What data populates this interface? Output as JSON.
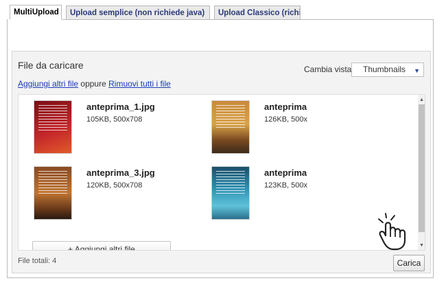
{
  "tabs": [
    {
      "label": "MultiUpload",
      "active": true
    },
    {
      "label": "Upload semplice (non richiede java)",
      "active": false
    },
    {
      "label": "Upload Classico (richi",
      "active": false
    }
  ],
  "panel": {
    "title": "File da caricare",
    "view_label": "Cambia vista:",
    "view_selected": "Thumbnails",
    "add_link": "Aggiungi altri file",
    "oppure": " oppure ",
    "remove_link": "Rimuovi tutti i file",
    "add_button": "+ Aggiungi altri file",
    "totals": "File totali: 4",
    "upload_button": "Carica"
  },
  "files": [
    {
      "name": "anteprima_1.jpg",
      "meta": "105KB, 500x708",
      "colors": [
        "#7a0f14",
        "#c3242a",
        "#e25a2a"
      ]
    },
    {
      "name": "anteprima",
      "meta": "126KB, 500x",
      "colors": [
        "#c98a3a",
        "#d9a24a",
        "#3d2a1a"
      ]
    },
    {
      "name": "anteprima_3.jpg",
      "meta": "120KB, 500x708",
      "colors": [
        "#8a4a22",
        "#c07432",
        "#2a1a10"
      ]
    },
    {
      "name": "anteprima",
      "meta": "123KB, 500x",
      "colors": [
        "#2f8fb0",
        "#5fc2d9",
        "#1c4f6a"
      ]
    }
  ],
  "icons": {
    "hand": "pointing-hand-icon",
    "caret": "chevron-down-icon"
  }
}
